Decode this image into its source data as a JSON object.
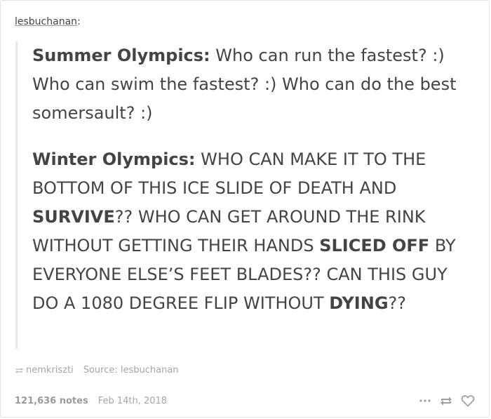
{
  "post": {
    "author": "lesbuchanan",
    "author_suffix": ":",
    "paragraph1": {
      "bold": "Summer Olympics:",
      "text": " Who can run the fastest? :) Who can swim the fastest? :) Who can do the best somersault? :)"
    },
    "paragraph2": {
      "bold1": "Winter Olympics:",
      "text1": " WHO CAN MAKE IT TO THE BOTTOM OF THIS ICE SLIDE OF DEATH AND ",
      "bold2": "SURVIVE",
      "text2": "?? WHO CAN GET AROUND THE RINK WITHOUT GETTING THEIR HANDS ",
      "bold3": "SLICED OFF",
      "text3": " BY EVERYONE ELSE’S FEET BLADES?? CAN THIS GUY DO A 1080 DEGREE FLIP WITHOUT ",
      "bold4": "DYING",
      "text4": "??"
    },
    "reblog": {
      "user": "nemkriszti",
      "source": "Source: lesbuchanan"
    },
    "footer": {
      "notes": "121,636 notes",
      "date": "Feb 14th, 2018"
    },
    "icons": {
      "reblog_small": "reblog-icon",
      "more": "ellipsis-icon",
      "reblog": "reblog-icon",
      "like": "heart-icon"
    },
    "colors": {
      "text": "#444444",
      "muted": "#a6a6a6",
      "quote_border": "#e7e7e7"
    }
  }
}
